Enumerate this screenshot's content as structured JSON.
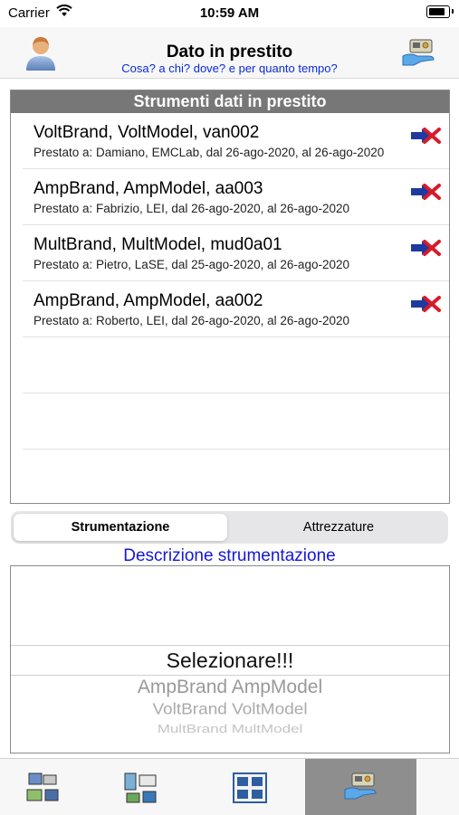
{
  "status_bar": {
    "carrier": "Carrier",
    "time": "10:59 AM"
  },
  "header": {
    "title": "Dato in prestito",
    "subtitle": "Cosa? a chi? dove? e per quanto tempo?"
  },
  "loan_list": {
    "heading": "Strumenti dati in prestito",
    "items": [
      {
        "name": "VoltBrand, VoltModel, van002",
        "detail": "Prestato a: Damiano, EMCLab, dal 26-ago-2020, al 26-ago-2020"
      },
      {
        "name": "AmpBrand, AmpModel, aa003",
        "detail": "Prestato a: Fabrizio, LEI, dal 26-ago-2020, al 26-ago-2020"
      },
      {
        "name": "MultBrand, MultModel, mud0a01",
        "detail": "Prestato a: Pietro, LaSE, dal 25-ago-2020, al 26-ago-2020"
      },
      {
        "name": "AmpBrand, AmpModel, aa002",
        "detail": "Prestato a: Roberto, LEI, dal 26-ago-2020, al 26-ago-2020"
      }
    ]
  },
  "segment": {
    "selected": "Strumentazione",
    "other": "Attrezzature"
  },
  "description_label": "Descrizione strumentazione",
  "picker": {
    "selected": "Selezionare!!!",
    "options": [
      "AmpBrand AmpModel",
      "VoltBrand VoltModel",
      "MultBrand MultModel"
    ]
  },
  "tabbar": {
    "tabs": [
      "instruments-tab-icon",
      "equipment-tab-icon",
      "calibration-tab-icon",
      "loan-tab-icon"
    ],
    "active_index": 3
  },
  "colors": {
    "link_blue": "#1418d8",
    "list_header": "#777777",
    "active_tab": "#8e8e8e"
  }
}
